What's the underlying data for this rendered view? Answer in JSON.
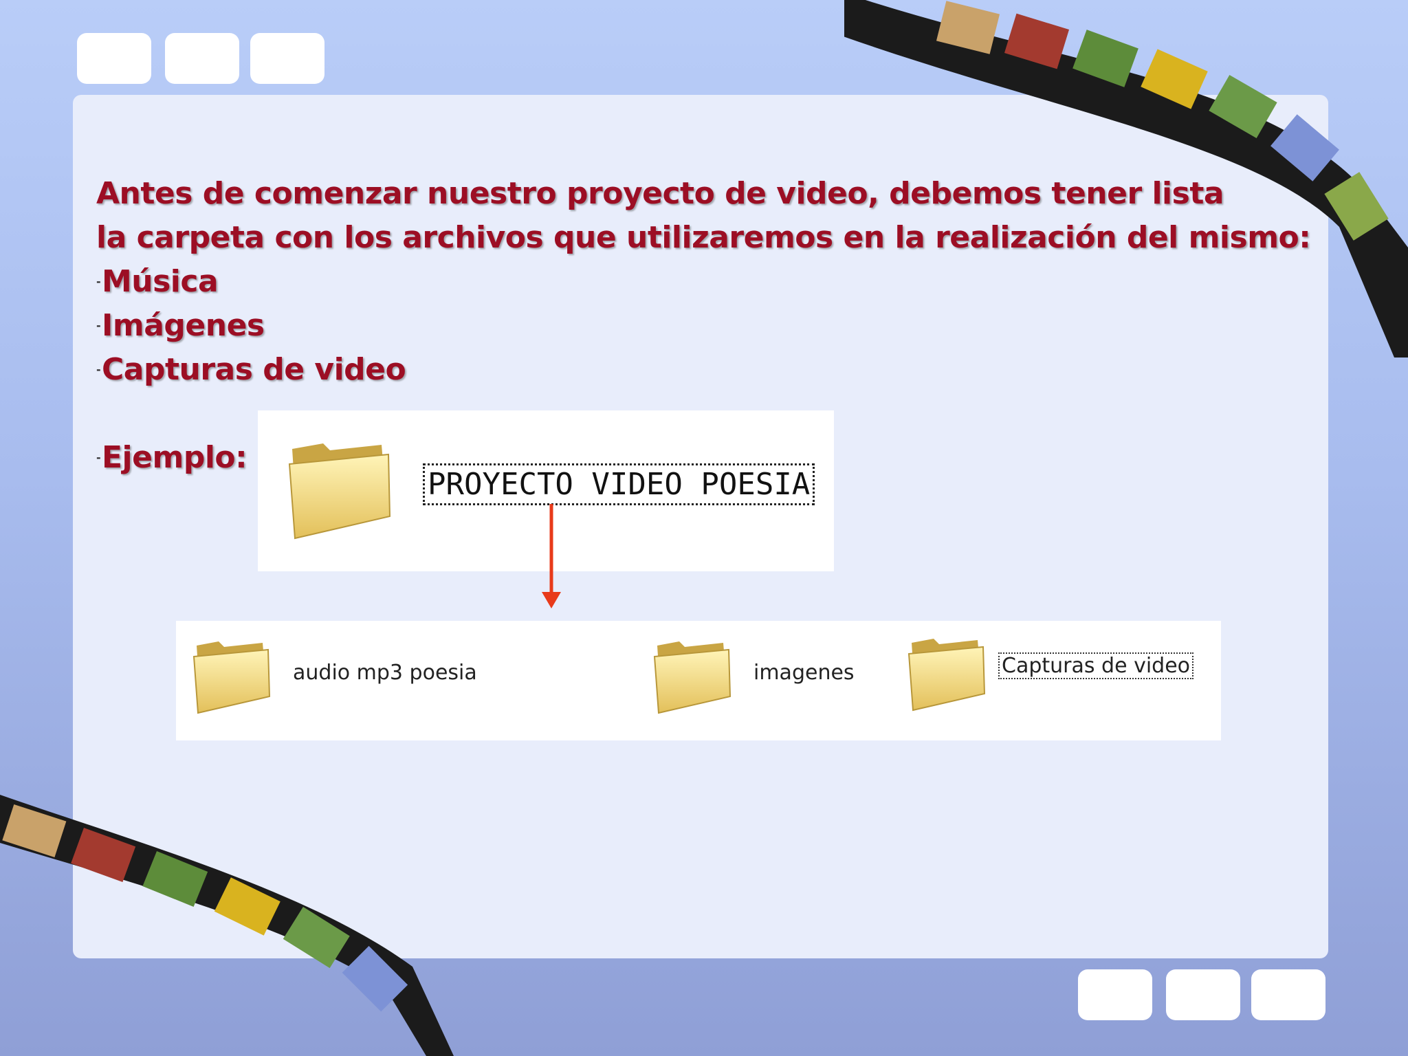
{
  "slide": {
    "heading_line1": "Antes de comenzar nuestro proyecto de video, debemos tener lista",
    "heading_line2": "la carpeta con los archivos que utilizaremos en la realización del mismo:",
    "items": [
      "Música",
      "Imágenes",
      "Capturas de video"
    ],
    "example_label": "Ejemplo:"
  },
  "example": {
    "main_folder": "PROYECTO VIDEO POESIA",
    "subfolders": [
      "audio mp3 poesia",
      "imagenes",
      "Capturas de video"
    ]
  },
  "colors": {
    "heading": "#9c0e24",
    "arrow": "#e83a1a",
    "panel": "#e8edfb"
  }
}
